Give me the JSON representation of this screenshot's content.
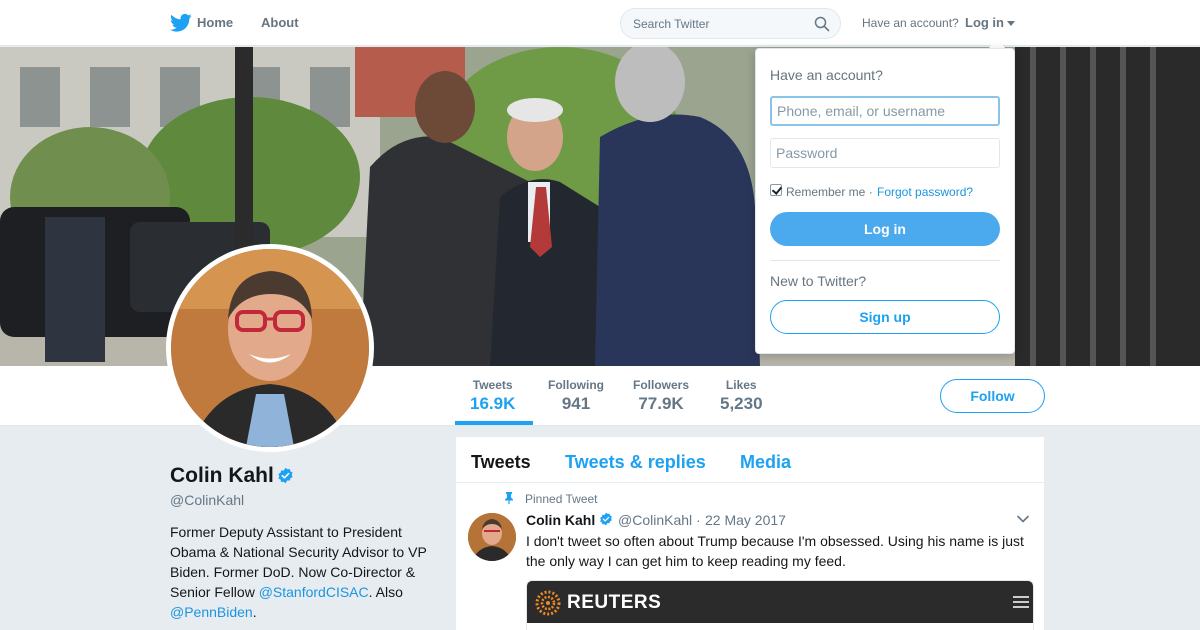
{
  "nav": {
    "home_label": "Home",
    "about_label": "About",
    "search_placeholder": "Search Twitter",
    "have_account": "Have an account?",
    "login_label": "Log in"
  },
  "profile": {
    "name": "Colin Kahl",
    "handle": "@ColinKahl",
    "bio_text_1": "Former Deputy Assistant to President Obama & National Security Advisor to VP Biden. Former DoD. Now Co-Director & Senior Fellow ",
    "bio_link_1": "@StanfordCISAC",
    "bio_text_2": ". Also ",
    "bio_link_2": "@PennBiden",
    "bio_text_3": "."
  },
  "stats": [
    {
      "label": "Tweets",
      "value": "16.9K",
      "active": true
    },
    {
      "label": "Following",
      "value": "941",
      "active": false
    },
    {
      "label": "Followers",
      "value": "77.9K",
      "active": false
    },
    {
      "label": "Likes",
      "value": "5,230",
      "active": false
    }
  ],
  "follow_label": "Follow",
  "stream": {
    "tabs": [
      "Tweets",
      "Tweets & replies",
      "Media"
    ],
    "pinned_label": "Pinned Tweet",
    "tweet": {
      "name": "Colin Kahl",
      "handle": "@ColinKahl",
      "separator": "·",
      "date": "22 May 2017",
      "text": "I don't tweet so often about Trump because I'm obsessed. Using his name is just the only way I can get him to keep reading my feed.",
      "media_brand": "REUTERS"
    }
  },
  "login_dropdown": {
    "title": "Have an account?",
    "username_placeholder": "Phone, email, or username",
    "password_placeholder": "Password",
    "remember_label": "Remember me",
    "separator": " · ",
    "forgot_label": "Forgot password?",
    "login_button": "Log in",
    "new_label": "New to Twitter?",
    "signup_button": "Sign up"
  },
  "colors": {
    "accent": "#1da1f2",
    "login_button": "#4ba9ee",
    "background": "#e6ecf0",
    "verified": "#1da1f2"
  },
  "icons": [
    "twitter-bird-icon",
    "search-icon",
    "caret-down-icon",
    "verified-icon",
    "pin-icon",
    "chevron-down-icon",
    "reuters-logo-icon",
    "hamburger-icon"
  ]
}
